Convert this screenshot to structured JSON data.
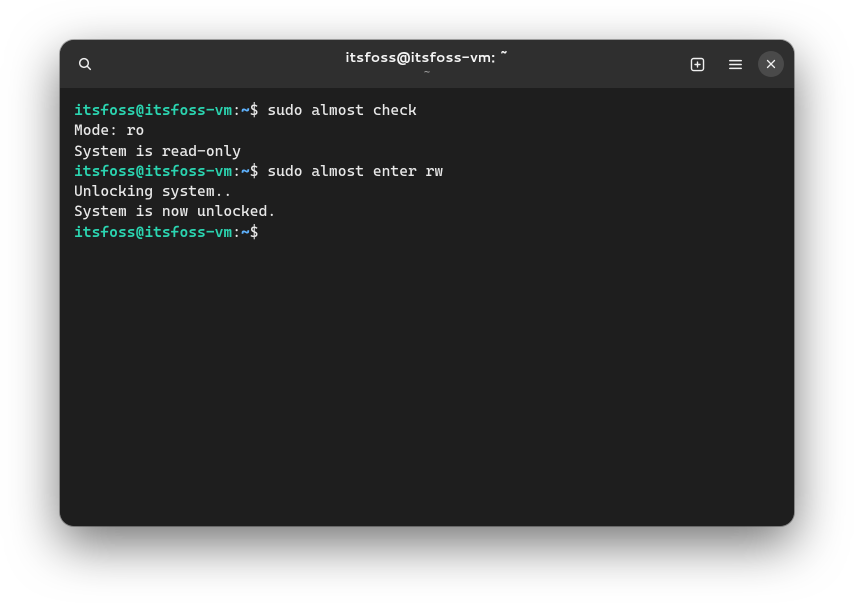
{
  "window": {
    "title": "itsfoss@itsfoss-vm: ~",
    "subtitle": "~"
  },
  "titlebar": {
    "icons": {
      "search": "search-icon",
      "new_tab": "new-tab-icon",
      "menu": "hamburger-icon",
      "close": "close-icon"
    }
  },
  "prompt": {
    "user_host": "itsfoss@itsfoss-vm",
    "separator": ":",
    "path": "~",
    "symbol": "$"
  },
  "session": {
    "lines": [
      {
        "type": "prompt",
        "command": "sudo almost check"
      },
      {
        "type": "output",
        "text": "Mode: ro"
      },
      {
        "type": "output",
        "text": "System is read-only"
      },
      {
        "type": "prompt",
        "command": "sudo almost enter rw"
      },
      {
        "type": "output",
        "text": "Unlocking system.."
      },
      {
        "type": "output",
        "text": "System is now unlocked."
      },
      {
        "type": "prompt",
        "command": ""
      }
    ]
  },
  "colors": {
    "bg": "#1e1e1e",
    "titlebar": "#2f2f2f",
    "text": "#e8e8e8",
    "prompt_user": "#2bd4b0",
    "prompt_path": "#5fb3ff",
    "close_btn": "#4a4a4a"
  }
}
